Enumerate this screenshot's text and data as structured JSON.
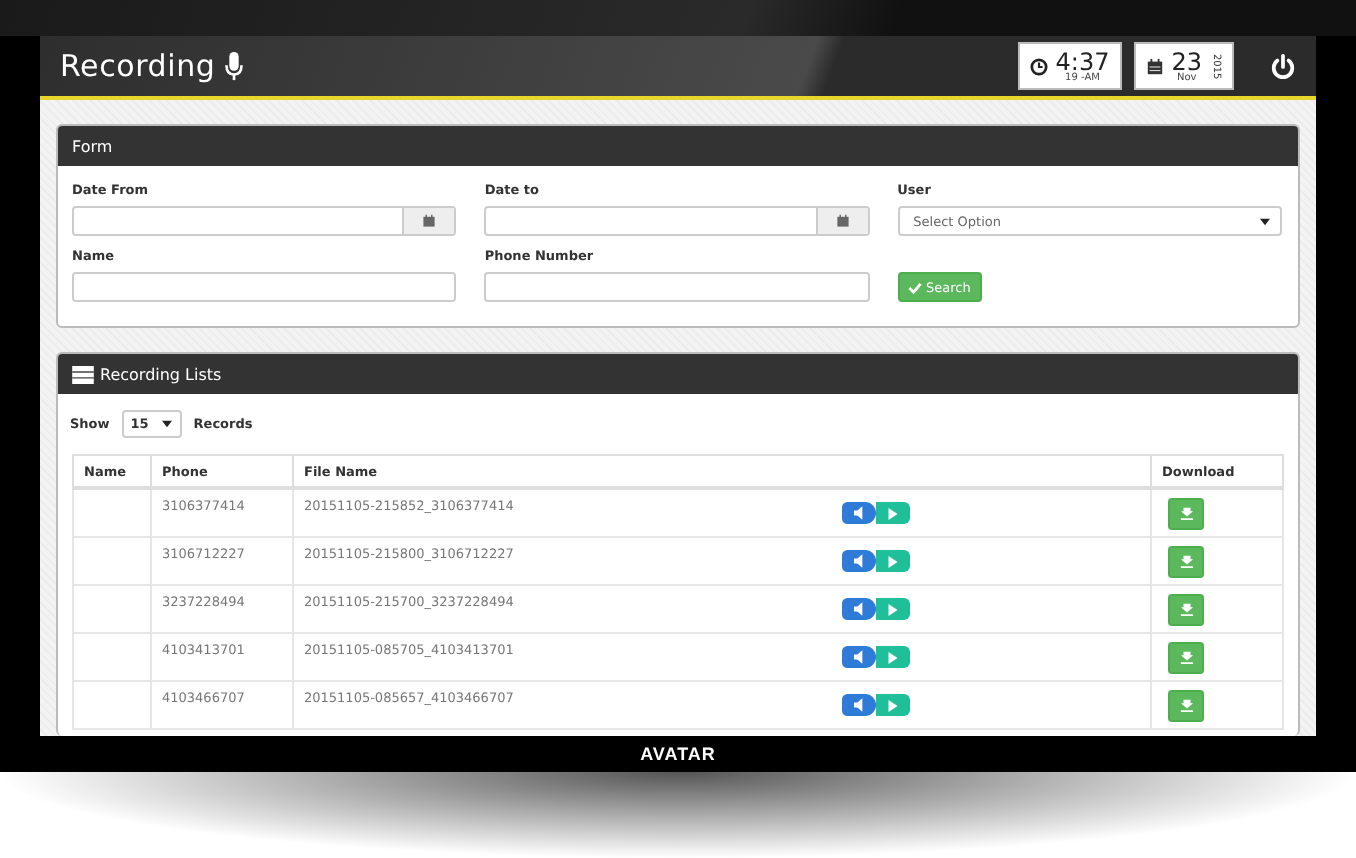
{
  "header": {
    "title": "Recording",
    "time": "4:37",
    "time_sub": "19 -AM",
    "day": "23",
    "month": "Nov",
    "year": "2015"
  },
  "form": {
    "title": "Form",
    "fields": [
      {
        "label": "Date From",
        "kind": "date"
      },
      {
        "label": "Date to",
        "kind": "date"
      },
      {
        "label": "User",
        "kind": "select",
        "placeholder": "Select Option"
      },
      {
        "label": "Name",
        "kind": "text"
      },
      {
        "label": "Phone Number",
        "kind": "text"
      }
    ],
    "search_button": "Search"
  },
  "list": {
    "title": "Recording Lists",
    "show_label": "Show",
    "page_size": "15",
    "records_label": "Records",
    "columns": [
      "Name",
      "Phone",
      "File Name",
      "Download"
    ],
    "rows": [
      {
        "phone": "3106377414",
        "file_name": "20151105-215852_3106377414"
      },
      {
        "phone": "3106712227",
        "file_name": "20151105-215800_3106712227"
      },
      {
        "phone": "3237228494",
        "file_name": "20151105-215700_3237228494"
      },
      {
        "phone": "4103413701",
        "file_name": "20151105-085705_4103413701"
      },
      {
        "phone": "4103466707",
        "file_name": "20151105-085657_4103466707"
      }
    ]
  },
  "footer": {
    "logo": "AVATAR"
  }
}
